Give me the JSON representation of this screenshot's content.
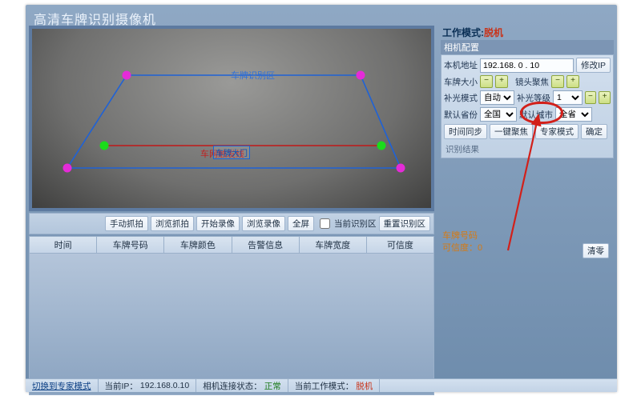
{
  "title": "高清车牌识别摄像机",
  "video": {
    "zone_label": "车牌识别区",
    "trigger_line_label": "车网触发线",
    "gate_box": "车牌大门"
  },
  "toolbar": {
    "manual_capture": "手动抓拍",
    "browse_capture": "浏览抓拍",
    "start_record": "开始录像",
    "browse_record": "浏览录像",
    "fullscreen": "全屏",
    "current_zone_chk": "当前识别区",
    "redraw_zone": "重置识别区"
  },
  "table": {
    "cols": [
      "时间",
      "车牌号码",
      "车牌颜色",
      "告警信息",
      "车牌宽度",
      "可信度"
    ]
  },
  "side": {
    "mode_label": "工作模式:",
    "mode_value": "脱机",
    "tab": "相机配置",
    "ip_label": "本机地址",
    "ip_value": "192.168. 0 . 10",
    "ip_btn": "修改IP",
    "plate_size": "车牌大小",
    "focus": "镜头聚焦",
    "fill_mode": "补光模式",
    "fill_mode_val": "自动",
    "fill_level": "补光等级",
    "fill_level_val": "1",
    "def_province": "默认省份",
    "def_province_val": "全国",
    "def_city": "默认城市",
    "def_city_val": "全省",
    "sync_time": "时间同步",
    "one_focus": "一键聚焦",
    "expert": "专家模式",
    "confirm": "确定",
    "result_head": "识别结果",
    "orange1": "车牌号码",
    "orange2_k": "可信度：",
    "orange2_v": "0",
    "clear": "清零"
  },
  "status": {
    "switch": "切换到专家模式",
    "ip_label": "当前IP：",
    "ip_val": "192.168.0.10",
    "conn_label": "相机连接状态：",
    "conn_val": "正常",
    "mode_label": "当前工作模式：",
    "mode_val": "脱机"
  }
}
